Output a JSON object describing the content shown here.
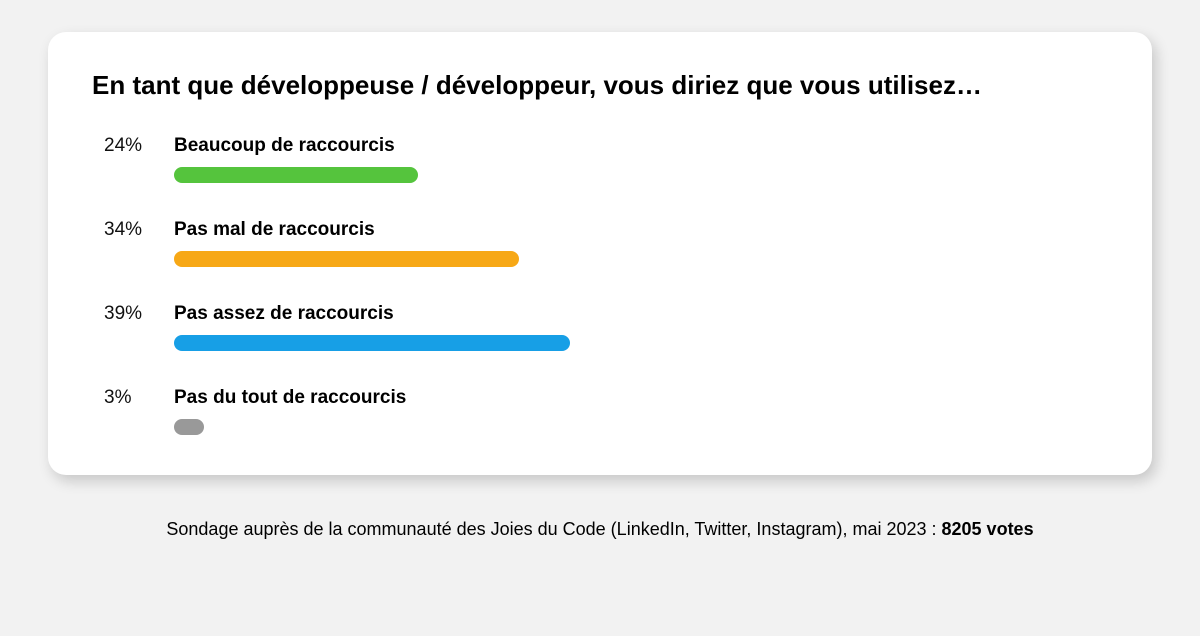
{
  "chart_data": {
    "type": "bar",
    "title": "En tant que développeuse / développeur, vous diriez que vous utilisez…",
    "categories": [
      "Beaucoup de raccourcis",
      "Pas mal de raccourcis",
      "Pas assez de raccourcis",
      "Pas du tout de raccourcis"
    ],
    "values": [
      24,
      34,
      39,
      3
    ],
    "unit": "%",
    "colors": [
      "#55c43d",
      "#f7a816",
      "#179fe6",
      "#999999"
    ],
    "xlabel": "",
    "ylabel": "",
    "ylim": [
      0,
      100
    ]
  },
  "caption": {
    "prefix": "Sondage auprès de la communauté des Joies du Code (LinkedIn, Twitter, Instagram), mai 2023 : ",
    "count": "8205 votes"
  }
}
